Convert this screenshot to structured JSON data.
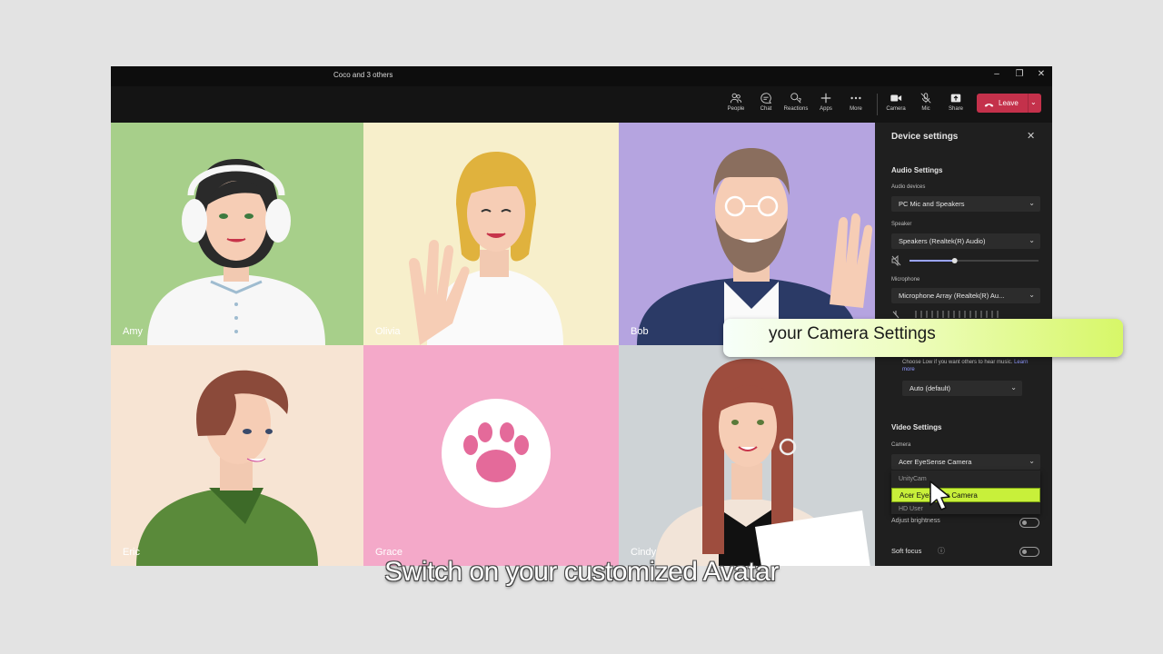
{
  "window": {
    "title": "Coco and 3 others"
  },
  "toolbar": {
    "people": "People",
    "chat": "Chat",
    "reactions": "Reactions",
    "apps": "Apps",
    "more": "More",
    "camera": "Camera",
    "mic": "Mic",
    "share": "Share",
    "leave": "Leave"
  },
  "tiles": {
    "amy": "Amy",
    "olivia": "Olivia",
    "bob": "Bob",
    "eric": "Eric",
    "grace": "Grace",
    "cindy": "Cindy"
  },
  "panel": {
    "title": "Device settings",
    "audio": {
      "heading": "Audio Settings",
      "devices_label": "Audio devices",
      "devices_value": "PC Mic and Speakers",
      "speaker_label": "Speaker",
      "speaker_value": "Speakers (Realtek(R) Audio)",
      "speaker_volume": 0.35,
      "microphone_label": "Microphone",
      "microphone_value": "Microphone Array (Realtek(R) Au...",
      "noise_help": "Choose Low if you want others to hear music.",
      "learn_more": "Learn more",
      "noise_value": "Auto (default)"
    },
    "video": {
      "heading": "Video Settings",
      "camera_label": "Camera",
      "camera_value": "Acer EyeSense Camera",
      "options": [
        "UnityCam",
        "Acer EyeSense Camera",
        "HD User"
      ],
      "adjust_brightness": "Adjust brightness",
      "soft_focus": "Soft focus"
    }
  },
  "banner": {
    "text": "your Camera Settings"
  },
  "subtitle": {
    "text": "Switch on your customized Avatar"
  },
  "colors": {
    "window_bg": "#1f1f1f",
    "leave": "#c4314b",
    "highlight": "#c8f03a",
    "amy_bg": "#a7cf8a",
    "olivia_bg": "#f7efcb",
    "bob_bg": "#b5a4e0",
    "eric_bg": "#f7e4d3",
    "grace_bg": "#f4a9c9",
    "cindy_bg": "#ced3d6"
  }
}
